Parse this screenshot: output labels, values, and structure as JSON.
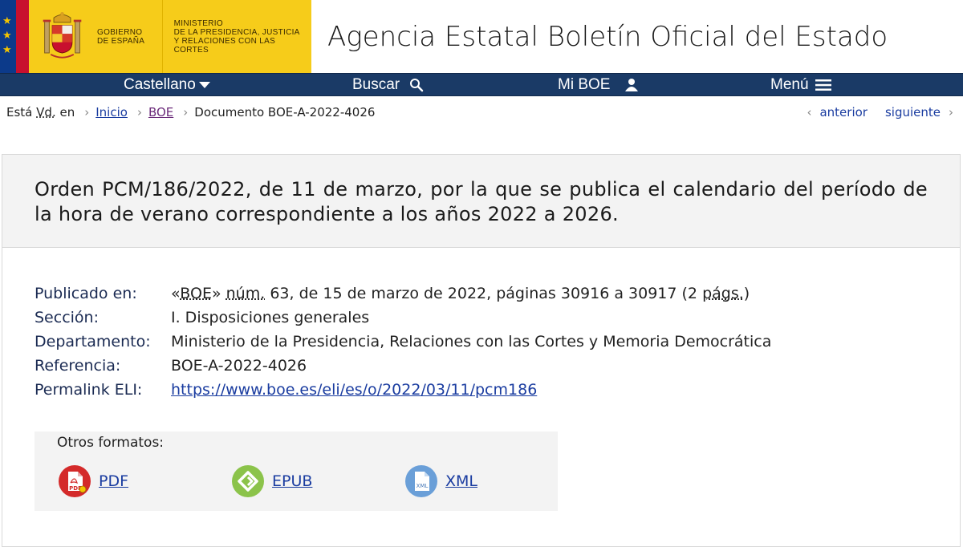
{
  "header": {
    "gov_name": [
      "GOBIERNO",
      "DE ESPAÑA"
    ],
    "ministry": [
      "MINISTERIO",
      "DE LA PRESIDENCIA, JUSTICIA",
      "Y RELACIONES CON LAS CORTES"
    ],
    "site_title": "Agencia Estatal Boletín Oficial del Estado"
  },
  "nav": {
    "language": "Castellano",
    "search": "Buscar",
    "my_boe": "Mi BOE",
    "menu": "Menú"
  },
  "breadcrumb": {
    "prefix_a": "Está",
    "prefix_abbr": "Vd.",
    "prefix_b": "en",
    "home": "Inicio",
    "boe": "BOE",
    "current": "Documento BOE-A-2022-4026",
    "previous": "anterior",
    "next": "siguiente"
  },
  "document": {
    "title": "Orden PCM/186/2022, de 11 de marzo, por la que se publica el calendario del período de la hora de verano correspondiente a los años 2022 a 2026.",
    "meta": {
      "published_label": "Publicado en:",
      "published_boe_open": "«",
      "published_boe": "BOE",
      "published_boe_close": "»",
      "published_num_abbr": "núm.",
      "published_rest": "63, de 15 de marzo de 2022, páginas 30916 a 30917 (2",
      "published_pages_abbr": "págs.",
      "published_end": ")",
      "section_label": "Sección:",
      "section_value": "I. Disposiciones generales",
      "department_label": "Departamento:",
      "department_value": "Ministerio de la Presidencia, Relaciones con las Cortes y Memoria Democrática",
      "reference_label": "Referencia:",
      "reference_value": "BOE-A-2022-4026",
      "permalink_label": "Permalink ELI:",
      "permalink_value": "https://www.boe.es/eli/es/o/2022/03/11/pcm186"
    },
    "formats": {
      "title": "Otros formatos:",
      "pdf": "PDF",
      "epub": "EPUB",
      "xml": "XML",
      "pdf_icon_text": "PDF",
      "xml_icon_text": "XML"
    }
  },
  "colors": {
    "nav_bg": "#1a3a66",
    "gov_yellow": "#f6cc1a",
    "link": "#1a3ca0",
    "pdf_red": "#d42a2a",
    "epub_green": "#8bc34a",
    "xml_blue": "#6a9fd8"
  },
  "icons": [
    "caret-down-icon",
    "search-icon",
    "user-icon",
    "hamburger-icon",
    "chevron-right-icon",
    "chevron-left-icon",
    "pdf-file-icon",
    "epub-icon",
    "xml-file-icon",
    "coat-of-arms",
    "eu-stars"
  ]
}
